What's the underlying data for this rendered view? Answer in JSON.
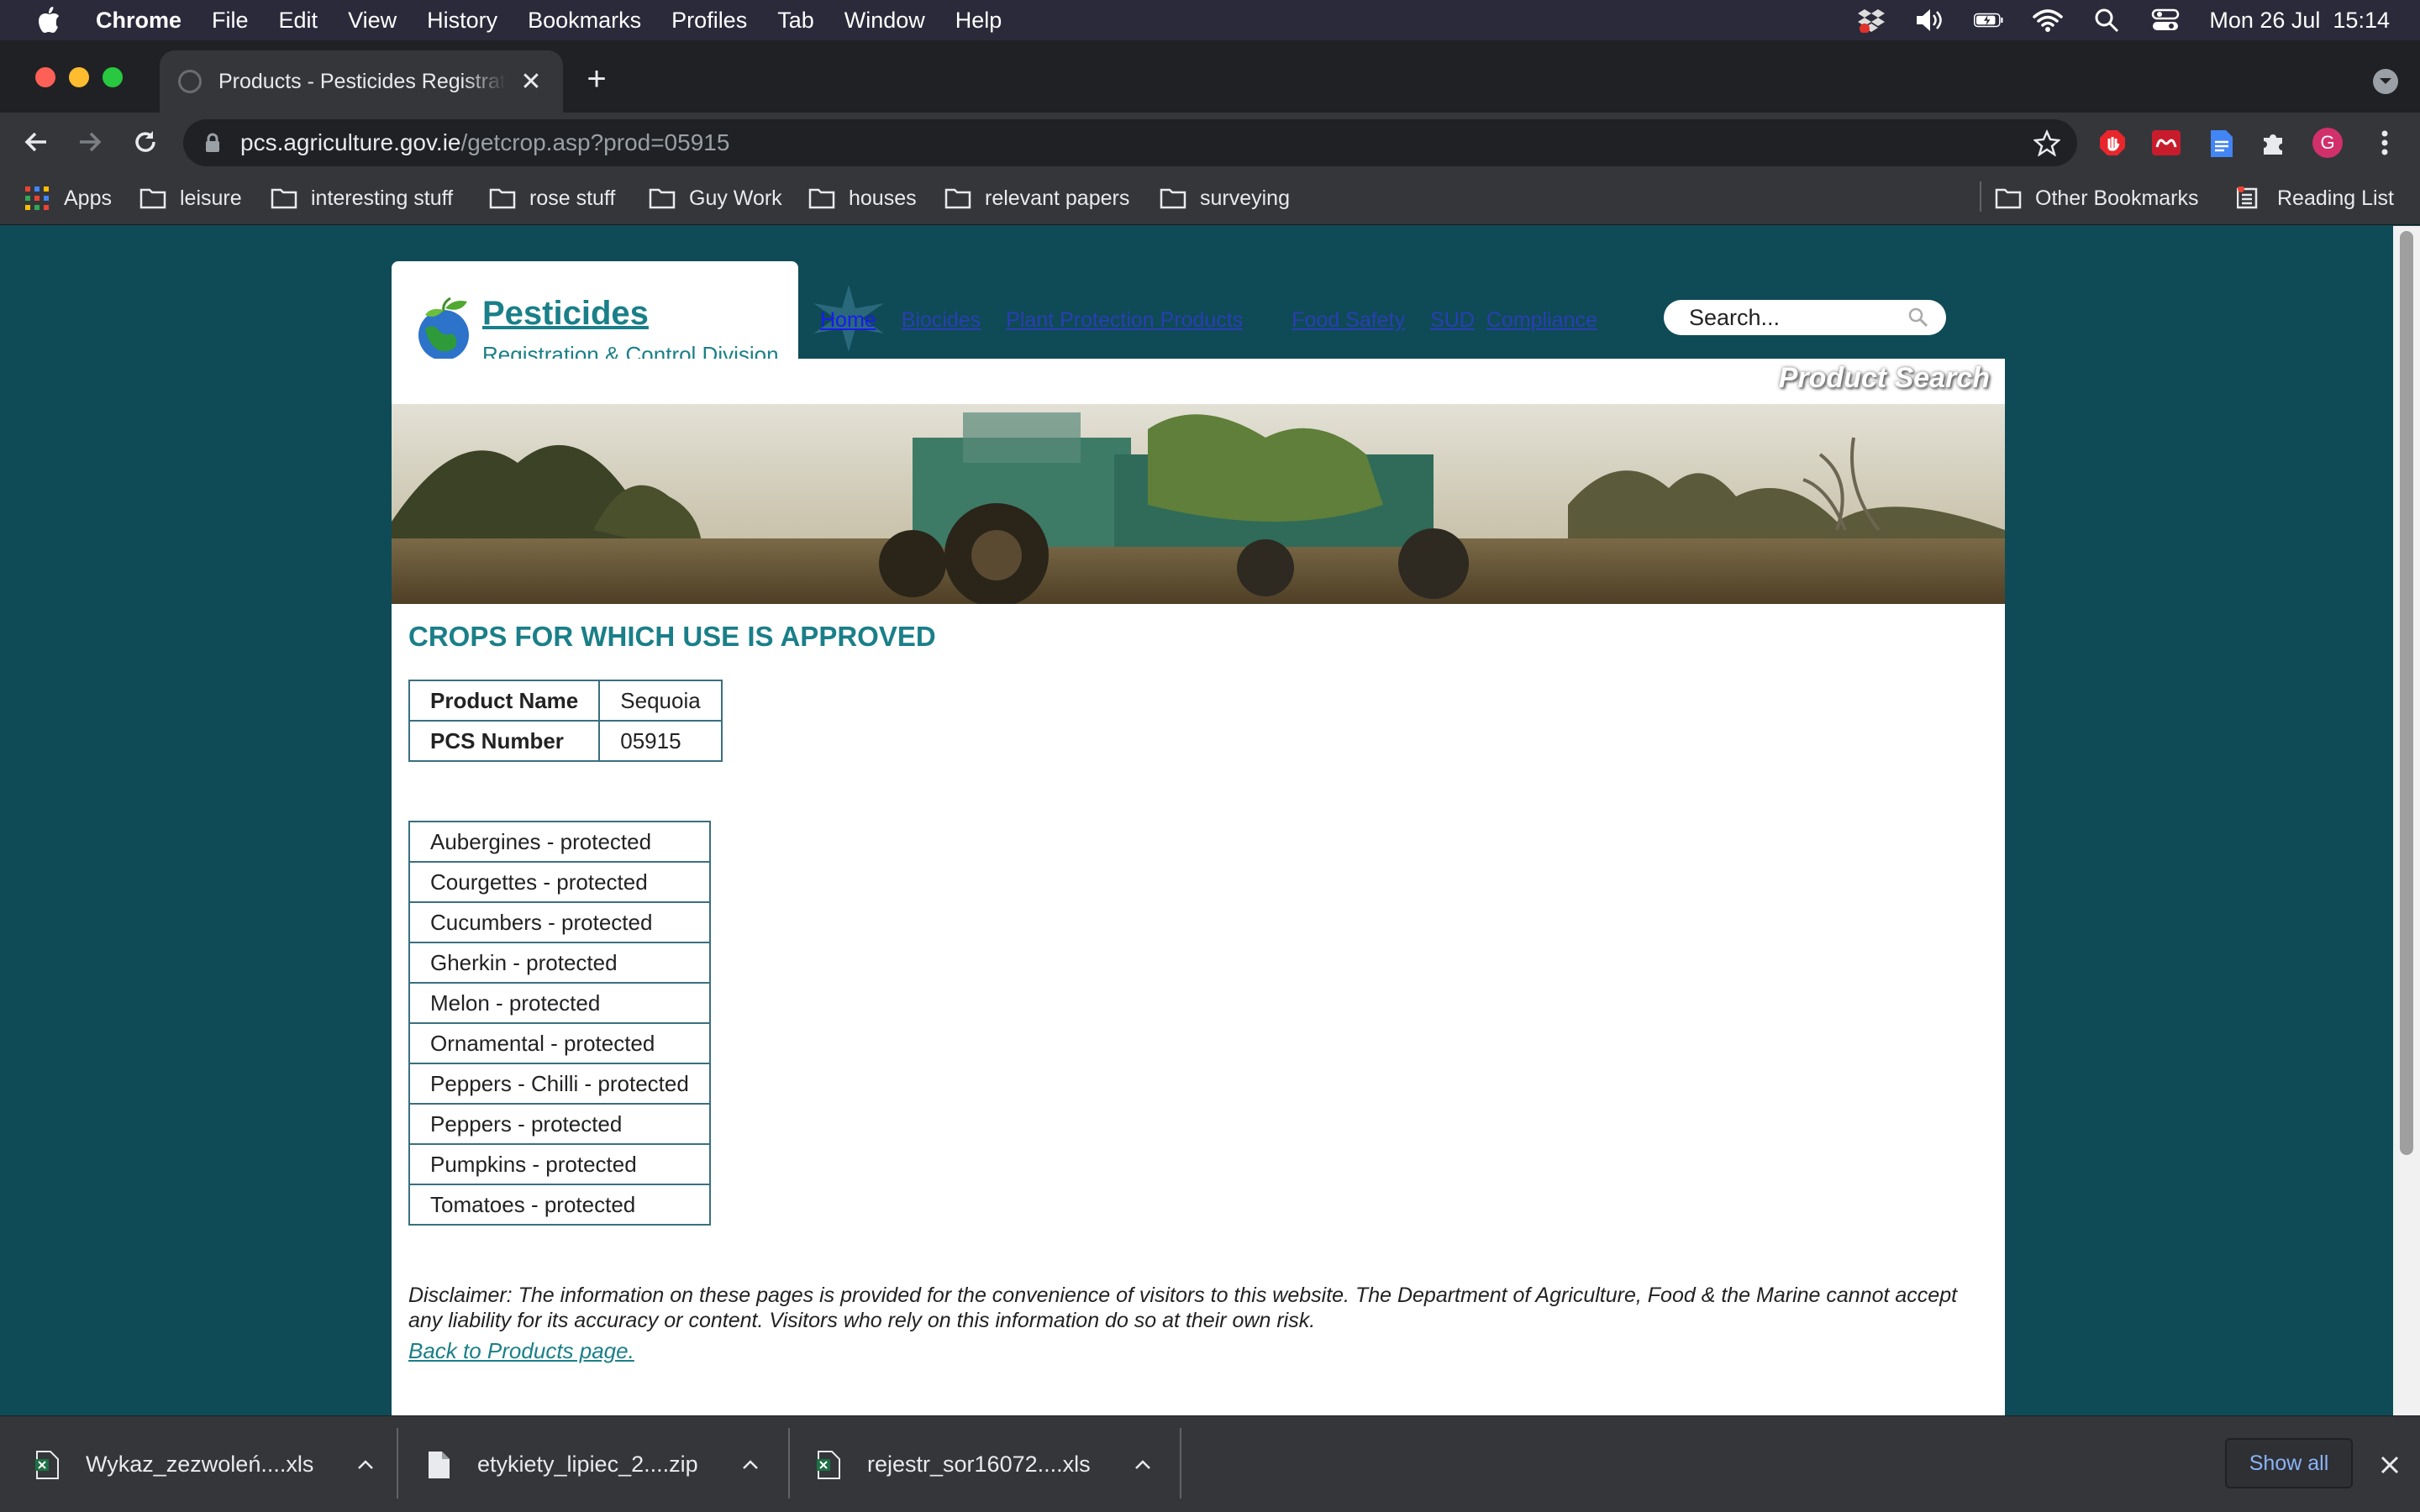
{
  "menubar": {
    "app": "Chrome",
    "items": [
      "File",
      "Edit",
      "View",
      "History",
      "Bookmarks",
      "Profiles",
      "Tab",
      "Window",
      "Help"
    ],
    "clock": "Mon 26 Jul  15:14"
  },
  "tab": {
    "title": "Products - Pesticides Registration"
  },
  "address": {
    "host": "pcs.agriculture.gov.ie",
    "path": "/getcrop.asp?prod=05915"
  },
  "bookmarks": {
    "apps": "Apps",
    "folders": [
      "leisure",
      "interesting stuff",
      "rose stuff",
      "Guy Work",
      "houses",
      "relevant papers",
      "surveying"
    ],
    "other": "Other Bookmarks",
    "reading_list": "Reading List"
  },
  "site": {
    "logo_title": "Pesticides",
    "logo_subtitle": "Registration & Control Division",
    "nav": [
      "Home",
      "Biocides",
      "Plant Protection Products",
      "Food Safety",
      "SUD",
      "Compliance"
    ],
    "search_placeholder": "Search...",
    "section_title": "Product Search"
  },
  "main": {
    "heading": "CROPS FOR WHICH USE IS APPROVED",
    "product": {
      "name_label": "Product Name",
      "name_value": "Sequoia",
      "pcs_label": "PCS Number",
      "pcs_value": "05915"
    },
    "crops": [
      "Aubergines - protected",
      "Courgettes - protected",
      "Cucumbers - protected",
      "Gherkin - protected",
      "Melon - protected",
      "Ornamental - protected",
      "Peppers - Chilli - protected",
      "Peppers - protected",
      "Pumpkins - protected",
      "Tomatoes - protected"
    ],
    "disclaimer": "Disclaimer: The information on these pages is provided for the convenience of visitors to this website. The Department of Agriculture, Food & the Marine cannot accept any liability for its accuracy or content. Visitors who rely on this information do so at their own risk.",
    "back_link": "Back to Products page."
  },
  "downloads": {
    "files": [
      "Wykaz_zezwoleń....xls",
      "etykiety_lipiec_2....zip",
      "rejestr_sor16072....xls"
    ],
    "show_all": "Show all"
  },
  "colors": {
    "page_background": "#0e4b56",
    "site_accent": "#1a7f88",
    "link_blue": "#1a1aee",
    "chrome_dark": "#202124",
    "chrome_toolbar": "#35363a"
  }
}
